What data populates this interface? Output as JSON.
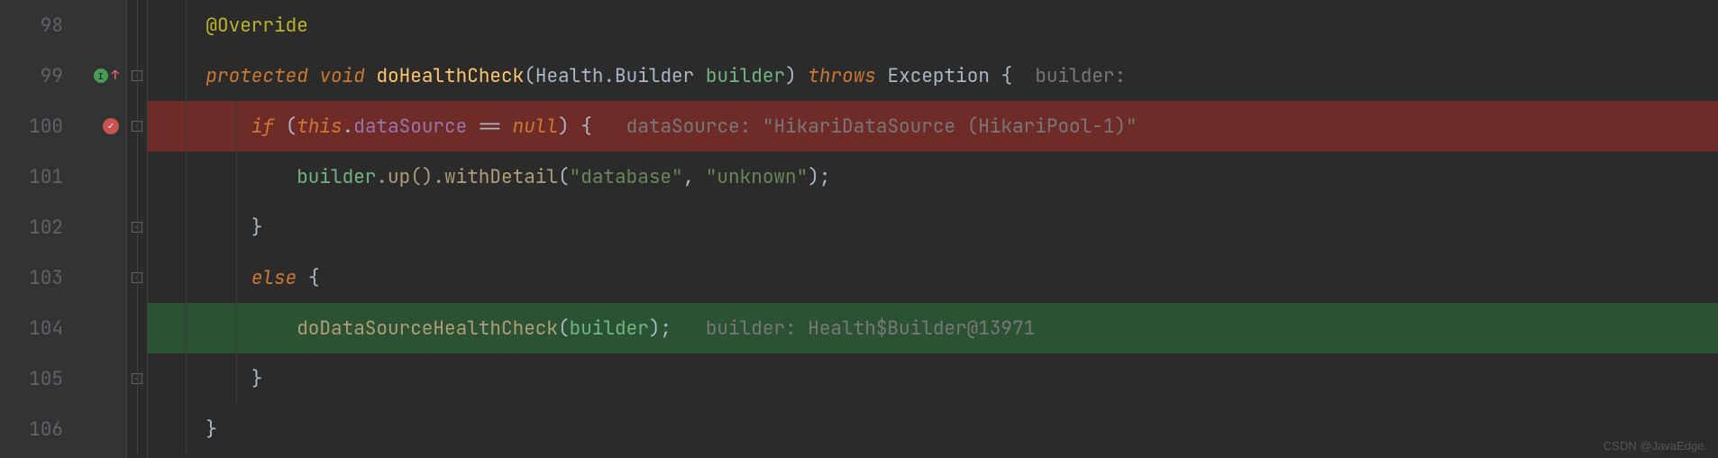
{
  "lines": {
    "98": {
      "num": "98",
      "annotation": "@Override"
    },
    "99": {
      "num": "99",
      "kw_protected": "protected",
      "kw_void": "void",
      "method": "doHealthCheck",
      "param_type": "Health.Builder",
      "param_name": "builder",
      "kw_throws": "throws",
      "exception": "Exception",
      "brace": " {",
      "hint_label": "  builder:"
    },
    "100": {
      "num": "100",
      "kw_if": "if",
      "open": " (",
      "kw_this": "this",
      "dot": ".",
      "field": "dataSource",
      "eq": " == ",
      "kw_null": "null",
      "close": ") {",
      "hint": "   dataSource: \"HikariDataSource (HikariPool-1)\""
    },
    "101": {
      "num": "101",
      "var": "builder",
      "m1": ".up().withDetail",
      "open": "(",
      "str1": "\"database\"",
      "comma": ", ",
      "str2": "\"unknown\"",
      "close": ");"
    },
    "102": {
      "num": "102",
      "brace": "}"
    },
    "103": {
      "num": "103",
      "kw_else": "else",
      "brace": " {"
    },
    "104": {
      "num": "104",
      "method": "doDataSourceHealthCheck",
      "open": "(",
      "arg": "builder",
      "close": ");",
      "hint": "   builder: Health$Builder@13971"
    },
    "105": {
      "num": "105",
      "brace": "}"
    },
    "106": {
      "num": "106",
      "brace": "}"
    }
  },
  "watermark": "CSDN @JavaEdge."
}
